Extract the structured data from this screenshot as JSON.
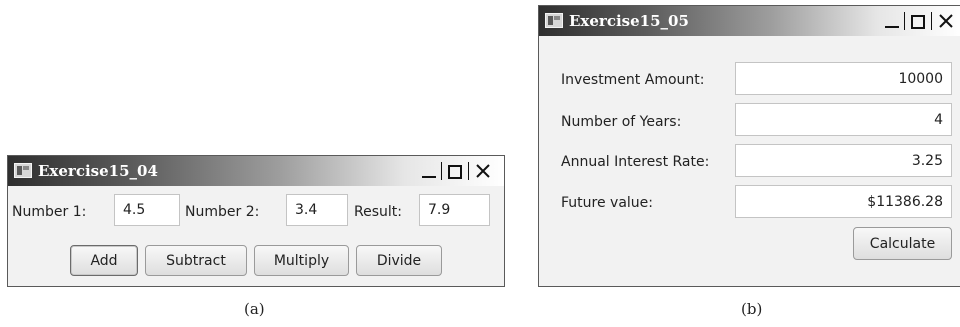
{
  "window_a": {
    "title": "Exercise15_04",
    "number1_label": "Number 1:",
    "number1_value": "4.5",
    "number2_label": "Number 2:",
    "number2_value": "3.4",
    "result_label": "Result:",
    "result_value": "7.9",
    "buttons": {
      "add": "Add",
      "subtract": "Subtract",
      "multiply": "Multiply",
      "divide": "Divide"
    },
    "caption": "(a)"
  },
  "window_b": {
    "title": "Exercise15_05",
    "rows": [
      {
        "label": "Investment Amount:",
        "value": "10000"
      },
      {
        "label": "Number of Years:",
        "value": "4"
      },
      {
        "label": "Annual Interest Rate:",
        "value": "3.25"
      },
      {
        "label": "Future value:",
        "value": "$11386.28"
      }
    ],
    "calculate_label": "Calculate",
    "caption": "(b)"
  },
  "icons": [
    "app-icon",
    "minimize-icon",
    "maximize-icon",
    "close-icon"
  ]
}
